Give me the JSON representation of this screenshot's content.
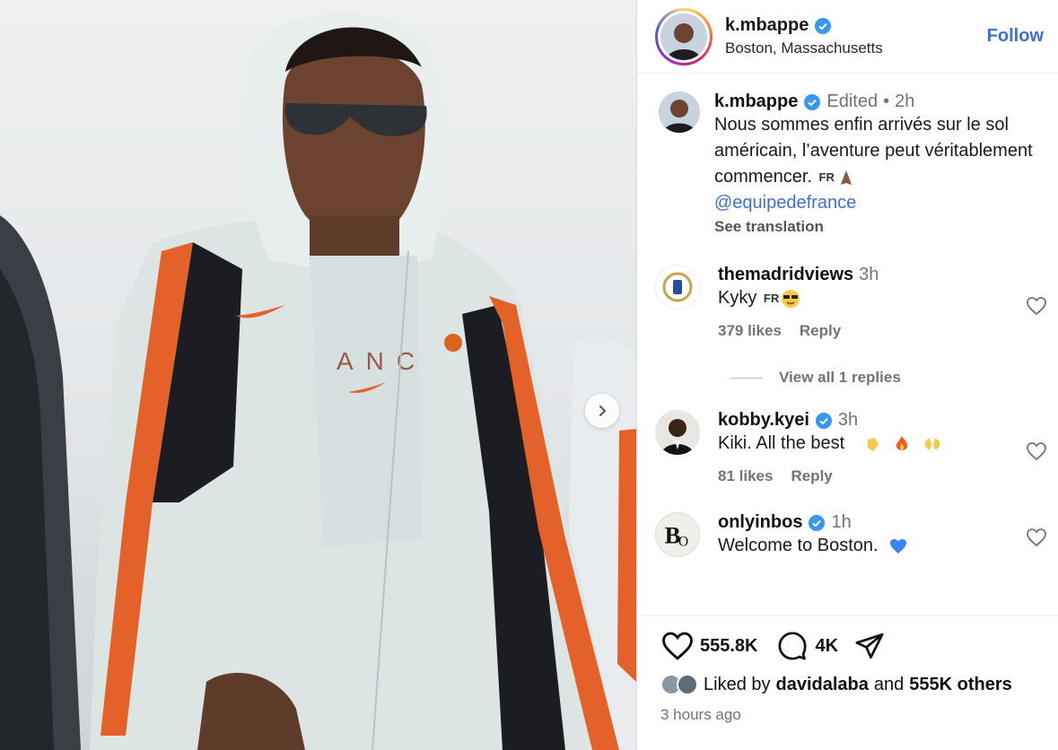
{
  "header": {
    "username": "k.mbappe",
    "location": "Boston, Massachusetts",
    "follow_label": "Follow"
  },
  "caption": {
    "username": "k.mbappe",
    "edited": "Edited",
    "separator": "•",
    "time": "2h",
    "text": "Nous sommes enfin arrivés sur le sol américain, l’aventure peut véritablement commencer.",
    "flag": "FR",
    "mention": "@equipedefrance",
    "see_translation": "See translation"
  },
  "comments": [
    {
      "username": "themadridviews",
      "time": "3h",
      "text": "Kyky",
      "flag": "FR",
      "likes": "379 likes",
      "reply": "Reply",
      "verified": false
    },
    {
      "username": "kobby.kyei",
      "time": "3h",
      "text": "Kiki. All the best",
      "likes": "81 likes",
      "reply": "Reply",
      "verified": true
    },
    {
      "username": "onlyinbos",
      "time": "1h",
      "text": "Welcome to Boston.",
      "verified": true
    }
  ],
  "view_replies": "View all 1 replies",
  "stats": {
    "likes": "555.8K",
    "comments": "4K"
  },
  "liked_by": {
    "prefix": "Liked by",
    "user": "davidalaba",
    "and": "and",
    "others": "555K others"
  },
  "posted": "3 hours ago",
  "colors": {
    "accent": "#3f6fd8",
    "jacket_orange": "#e4612a",
    "jacket_black": "#1c1d22"
  },
  "icons": [
    "verified-badge-icon",
    "heart-icon",
    "comment-icon",
    "share-icon",
    "chevron-right-icon"
  ]
}
